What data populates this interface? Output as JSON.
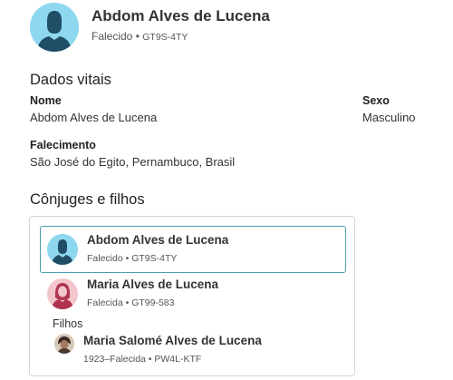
{
  "header": {
    "name": "Abdom Alves de Lucena",
    "status": "Falecido",
    "separator": "•",
    "id": "GT9S-4TY"
  },
  "vitals": {
    "title": "Dados vitais",
    "name_label": "Nome",
    "name_value": "Abdom Alves de Lucena",
    "sex_label": "Sexo",
    "sex_value": "Masculino",
    "death_label": "Falecimento",
    "death_value": "São José do Egito, Pernambuco, Brasil"
  },
  "family": {
    "title": "Cônjuges e filhos",
    "spouses": [
      {
        "name": "Abdom Alves de Lucena",
        "meta": "Falecido • GT9S-4TY",
        "avatar": "male-avatar-icon",
        "selected": true
      },
      {
        "name": "Maria Alves de Lucena",
        "meta": "Falecida • GT99-583",
        "avatar": "female-avatar-icon",
        "selected": false
      }
    ],
    "children_label": "Filhos",
    "children": [
      {
        "name": "Maria Salomé Alves de Lucena",
        "meta": "1923–Falecida • PW4L-KTF",
        "avatar": "photo-avatar-icon"
      }
    ]
  },
  "colors": {
    "male_avatar_bg": "#8ed8ef",
    "male_silhouette": "#1f4e66",
    "female_avatar_bg": "#f3c6cd",
    "female_silhouette": "#b0344f",
    "selected_border": "#4a9fae"
  }
}
